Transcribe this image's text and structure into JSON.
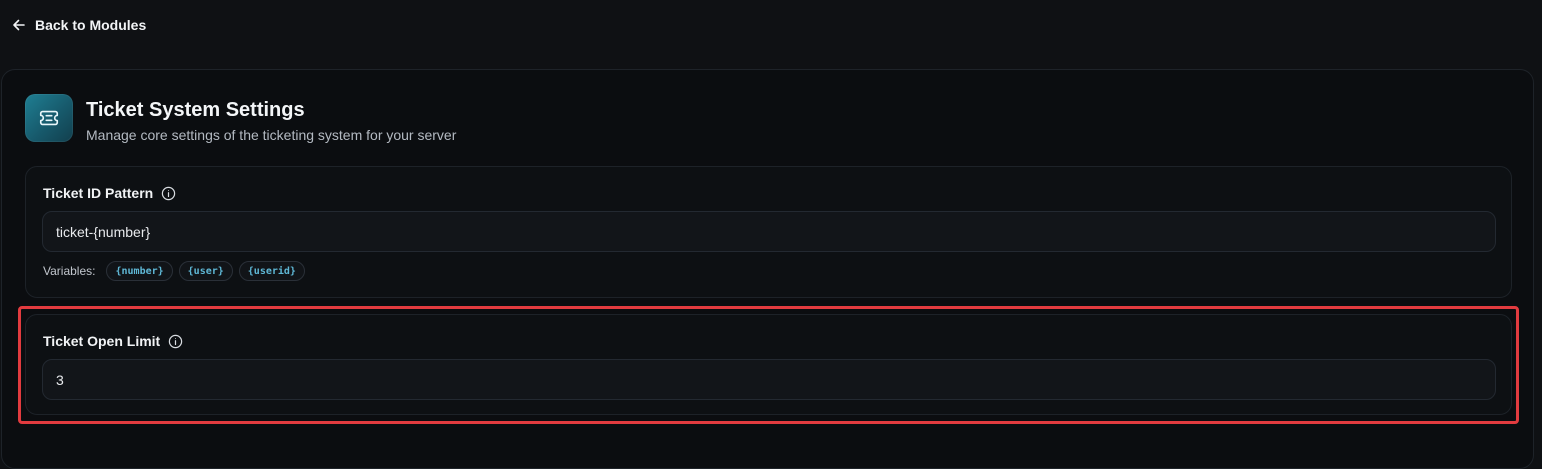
{
  "nav": {
    "back_label": "Back to Modules",
    "back_icon": "arrow-left-icon"
  },
  "header": {
    "icon": "ticket-icon",
    "title": "Ticket System Settings",
    "subtitle": "Manage core settings of the ticketing system for your server"
  },
  "ticket_id_pattern": {
    "label": "Ticket ID Pattern",
    "info_icon": "info-icon",
    "value": "ticket-{number}",
    "variables_label": "Variables:",
    "variables": [
      "{number}",
      "{user}",
      "{userid}"
    ]
  },
  "ticket_open_limit": {
    "label": "Ticket Open Limit",
    "info_icon": "info-icon",
    "value": "3"
  },
  "colors": {
    "background": "#0f1114",
    "panel": "#0b0d10",
    "accent_chip_text": "#5fb8d6",
    "icon_gradient": "#1f7f93",
    "highlight": "#e23b3f"
  }
}
